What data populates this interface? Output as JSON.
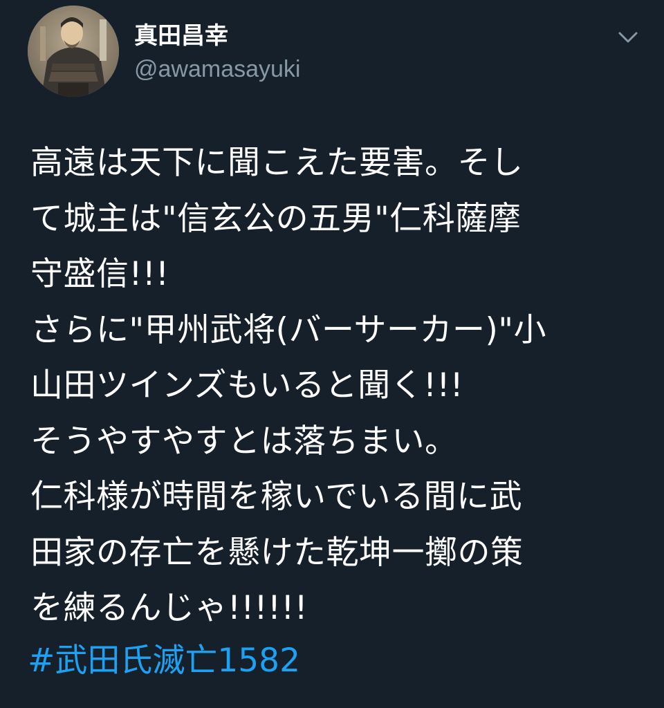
{
  "author": {
    "display_name": "真田昌幸",
    "handle": "@awamasayuki",
    "avatar_icon": "portrait-avatar-icon"
  },
  "menu": {
    "icon": "chevron-down-icon"
  },
  "tweet": {
    "lines": [
      "高遠は天下に聞こえた要害。そし",
      "て城主は\"信玄公の五男\"仁科薩摩",
      "守盛信!!!",
      "さらに\"甲州武将(バーサーカー)\"小",
      "山田ツインズもいると聞く!!!",
      "そうやすやすとは落ちまい。",
      "仁科様が時間を稼いでいる間に武",
      "田家の存亡を懸けた乾坤一擲の策",
      "を練るんじゃ!!!!!!"
    ],
    "hashtag": "#武田氏滅亡1582"
  },
  "colors": {
    "background": "#15202b",
    "text": "#ffffff",
    "secondary_text": "#8899a6",
    "link": "#1da1f2"
  }
}
